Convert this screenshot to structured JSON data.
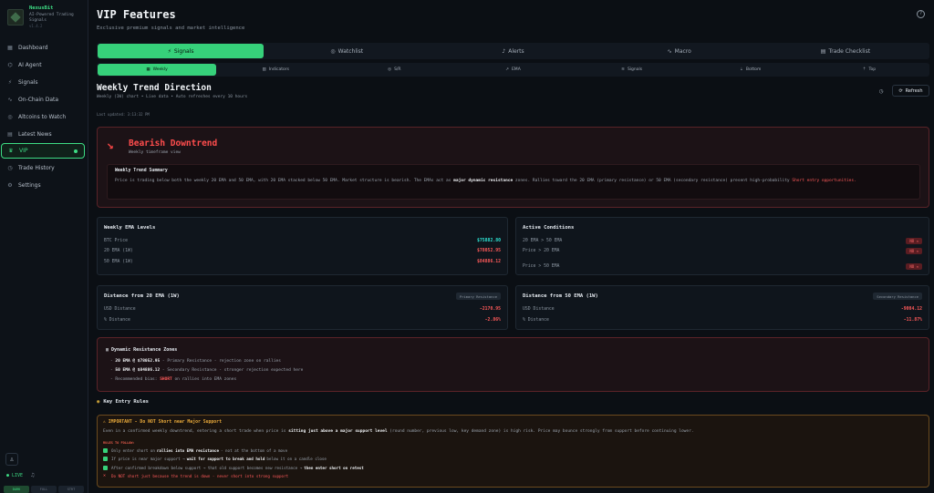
{
  "app": {
    "name": "NexusBit",
    "subtitle": "AI-Powered Trading Signals",
    "version": "v1.4.2"
  },
  "sidebar": {
    "items": [
      {
        "label": "Dashboard",
        "icon": "dashboard-icon"
      },
      {
        "label": "AI Agent",
        "icon": "bot-icon"
      },
      {
        "label": "Signals",
        "icon": "signal-icon"
      },
      {
        "label": "On-Chain Data",
        "icon": "activity-icon"
      },
      {
        "label": "Altcoins to Watch",
        "icon": "eye-icon"
      },
      {
        "label": "Latest News",
        "icon": "news-icon"
      },
      {
        "label": "VIP",
        "icon": "crown-icon"
      },
      {
        "label": "Trade History",
        "icon": "history-icon"
      },
      {
        "label": "Settings",
        "icon": "gear-icon"
      }
    ],
    "active_index": 6,
    "live_label": "LIVE",
    "modes": [
      "DARK",
      "FULL",
      "STRT"
    ]
  },
  "header": {
    "title": "VIP Features",
    "subtitle": "Exclusive premium signals and market intelligence"
  },
  "main_tabs": [
    {
      "label": "Signals",
      "icon": "⚡",
      "active": true
    },
    {
      "label": "Watchlist",
      "icon": "◎",
      "active": false
    },
    {
      "label": "Alerts",
      "icon": "♪",
      "active": false
    },
    {
      "label": "Macro",
      "icon": "∿",
      "active": false
    },
    {
      "label": "Trade Checklist",
      "icon": "▤",
      "active": false
    }
  ],
  "sub_tabs": [
    {
      "label": "Weekly",
      "icon": "▦",
      "active": true
    },
    {
      "label": "Indicators",
      "icon": "▥",
      "active": false
    },
    {
      "label": "S/R",
      "icon": "◎",
      "active": false
    },
    {
      "label": "EMA",
      "icon": "↗",
      "active": false
    },
    {
      "label": "Signals",
      "icon": "≋",
      "active": false
    },
    {
      "label": "Bottom",
      "icon": "⇣",
      "active": false
    },
    {
      "label": "Top",
      "icon": "⇡",
      "active": false
    }
  ],
  "section": {
    "title": "Weekly Trend Direction",
    "subtitle": "Weekly (1W) chart • Live data • Auto refreshes every 10 hours",
    "last_updated": "Last updated: 3:13:32 PM",
    "refresh_label": "Refresh"
  },
  "trend": {
    "name": "Bearish Downtrend",
    "timeframe": "Weekly timeframe view",
    "summary_title": "Weekly Trend Summary",
    "summary_text_1": "Price is trading below both the weekly 20 EMA and 50 EMA, with 20 EMA stacked below 50 EMA. Market structure is bearish. The EMAs act as ",
    "summary_bold": "major dynamic resistance",
    "summary_text_2": " zones. Rallies toward the 20 EMA (primary resistance) or 50 EMA (secondary resistance) present high-probability ",
    "summary_red": "Short entry opportunities."
  },
  "ema_levels": {
    "title": "Weekly EMA Levels",
    "rows": [
      {
        "label": "BTC Price",
        "value": "$75882.80"
      },
      {
        "label": "20 EMA (1W)",
        "value": "$78052.95"
      },
      {
        "label": "50 EMA (1W)",
        "value": "$84886.12"
      }
    ]
  },
  "conditions": {
    "title": "Active Conditions",
    "rows": [
      {
        "label": "20 EMA > 50 EMA",
        "value": "NO ✕"
      },
      {
        "label": "Price > 20 EMA",
        "value": "NO ✕"
      },
      {
        "label": "Price > 50 EMA",
        "value": "NO ✕"
      }
    ]
  },
  "dist20": {
    "title": "Distance from 20 EMA (1W)",
    "tag": "Primary Resistance",
    "rows": [
      {
        "label": "USD Distance",
        "value": "-2170.95"
      },
      {
        "label": "% Distance",
        "value": "-2.86%"
      }
    ]
  },
  "dist50": {
    "title": "Distance from 50 EMA (1W)",
    "tag": "Secondary Resistance",
    "rows": [
      {
        "label": "USD Distance",
        "value": "-9004.12"
      },
      {
        "label": "% Distance",
        "value": "-11.87%"
      }
    ]
  },
  "resistance": {
    "title": "Dynamic Resistance Zones",
    "line1_bold": "20 EMA @ $78052.95",
    "line1_rest": " - Primary Resistance - rejection zone on rallies",
    "line2_bold": "50 EMA @ $84886.12",
    "line2_rest": " - Secondary Resistance - stronger rejection expected here",
    "line3_pre": "- Recommended bias: ",
    "line3_red": "SHORT",
    "line3_post": " on rallies into EMA zones"
  },
  "rules": {
    "heading": "Key Entry Rules",
    "warn_title": "⚠ IMPORTANT - Do NOT Short near Major Support",
    "warn_pre": "Even in a confirmed weekly downtrend, entering a short trade when price is ",
    "warn_bold": "sitting just above a major support level",
    "warn_post": " (round number, previous low, key demand zone) is high risk. Price may bounce strongly from support before continuing lower.",
    "follow_title": "RULES TO FOLLOW:",
    "items": [
      {
        "pre": "Only enter short on ",
        "bold": "rallies into EMA resistance",
        "post": " - not at the bottom of a move",
        "bad": false
      },
      {
        "pre": "If price is near major support → ",
        "bold": "wait for support to break and hold",
        "post": " below it on a candle close",
        "bad": false
      },
      {
        "pre": "After confirmed breakdown below support → that old support becomes new resistance → ",
        "bold": "then enter short on retest",
        "post": "",
        "bad": false
      },
      {
        "pre": "Do NOT short just because the trend is down - never short into strong support",
        "bold": "",
        "post": "",
        "bad": true
      }
    ]
  },
  "colors": {
    "accent": "#36d17a",
    "bearish": "#ff4d4d",
    "price": "#2ee6d6",
    "warning": "#e8a93a"
  }
}
